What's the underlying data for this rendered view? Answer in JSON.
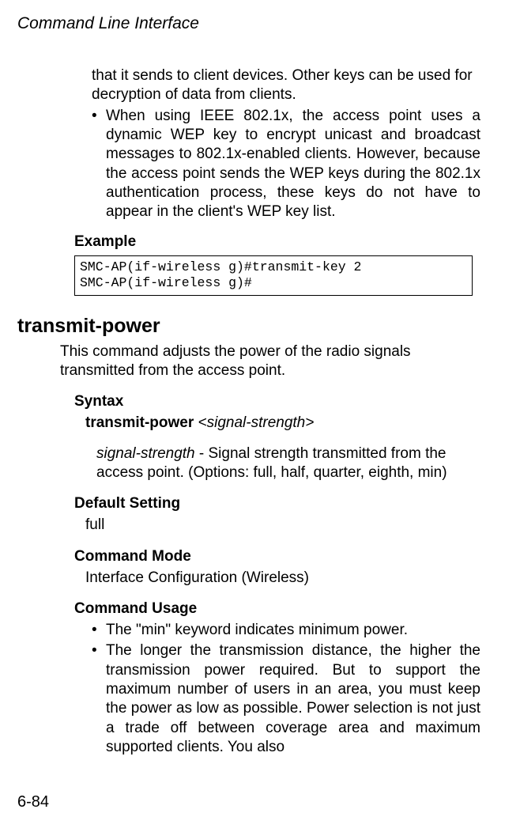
{
  "header": {
    "running_title": "Command Line Interface"
  },
  "prev_continuation": {
    "cont_text": "that it sends to client devices. Other keys can be used for decryption of data from clients.",
    "bullet2": "When using IEEE 802.1x, the access point uses a dynamic WEP key to encrypt unicast and broadcast messages to 802.1x-enabled clients. However, because the access point sends the WEP keys during the 802.1x authentication process, these keys do not have to appear in the client's WEP key list."
  },
  "example": {
    "label": "Example",
    "code": "SMC-AP(if-wireless g)#transmit-key 2\nSMC-AP(if-wireless g)#"
  },
  "command": {
    "name": "transmit-power",
    "description": "This command adjusts the power of the radio signals transmitted from the access point.",
    "syntax_label": "Syntax",
    "syntax_cmd": "transmit-power",
    "syntax_arg": "<signal-strength>",
    "param_name": "signal-strength",
    "param_desc": " - Signal strength transmitted from the access point. (Options: full, half, quarter, eighth, min)",
    "default_label": "Default Setting",
    "default_value": "full",
    "mode_label": "Command Mode",
    "mode_value": "Interface Configuration (Wireless)",
    "usage_label": "Command Usage",
    "usage_bullet1": "The \"min\" keyword indicates minimum power.",
    "usage_bullet2": "The longer the transmission distance, the higher the transmission power required. But to support the maximum number of users in an area, you must keep the power as low as possible. Power selection is not just a trade off between coverage area and maximum supported clients. You also"
  },
  "footer": {
    "page_number": "6-84"
  },
  "glyphs": {
    "bullet": "•"
  }
}
